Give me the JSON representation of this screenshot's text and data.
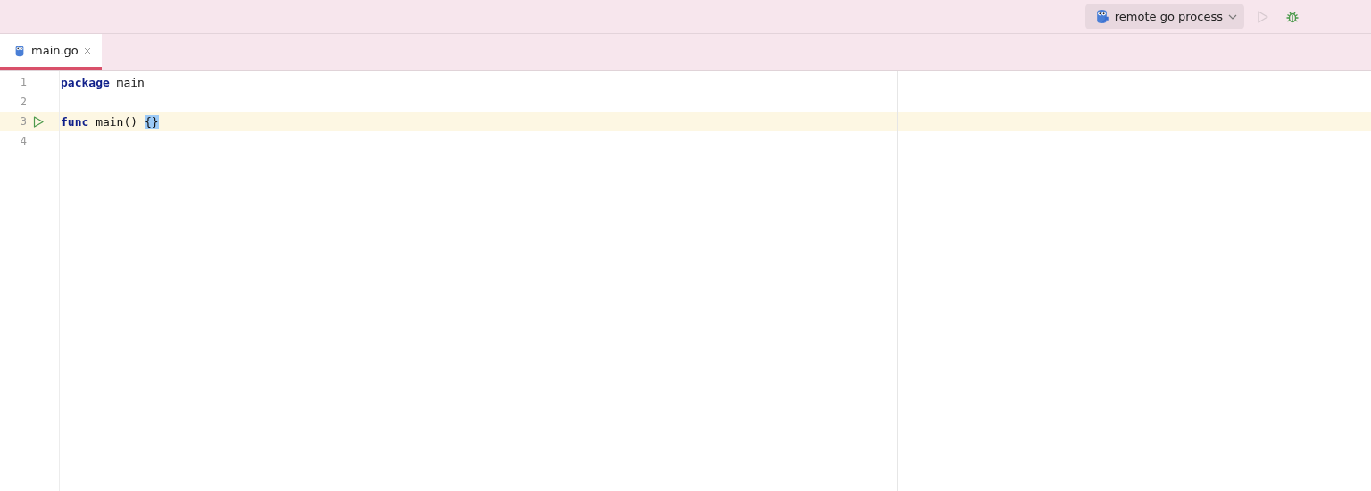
{
  "toolbar": {
    "run_configuration": {
      "label": "remote go process"
    },
    "run_button": {
      "disabled": true
    },
    "debug_button": {
      "disabled": false
    }
  },
  "tabs": [
    {
      "label": "main.go",
      "selected": true
    }
  ],
  "editor": {
    "lines": [
      {
        "number": "1",
        "current": false,
        "run_marker": false,
        "tokens": [
          {
            "text": "package",
            "kind": "keyword"
          },
          {
            "text": " main",
            "kind": "plain"
          }
        ]
      },
      {
        "number": "2",
        "current": false,
        "run_marker": false
      },
      {
        "number": "3",
        "current": true,
        "run_marker": true,
        "tokens": [
          {
            "text": "func",
            "kind": "keyword"
          },
          {
            "text": " main() ",
            "kind": "plain"
          },
          {
            "text": "{}",
            "kind": "matched_brace"
          }
        ]
      },
      {
        "number": "4",
        "current": false,
        "run_marker": false
      }
    ]
  }
}
